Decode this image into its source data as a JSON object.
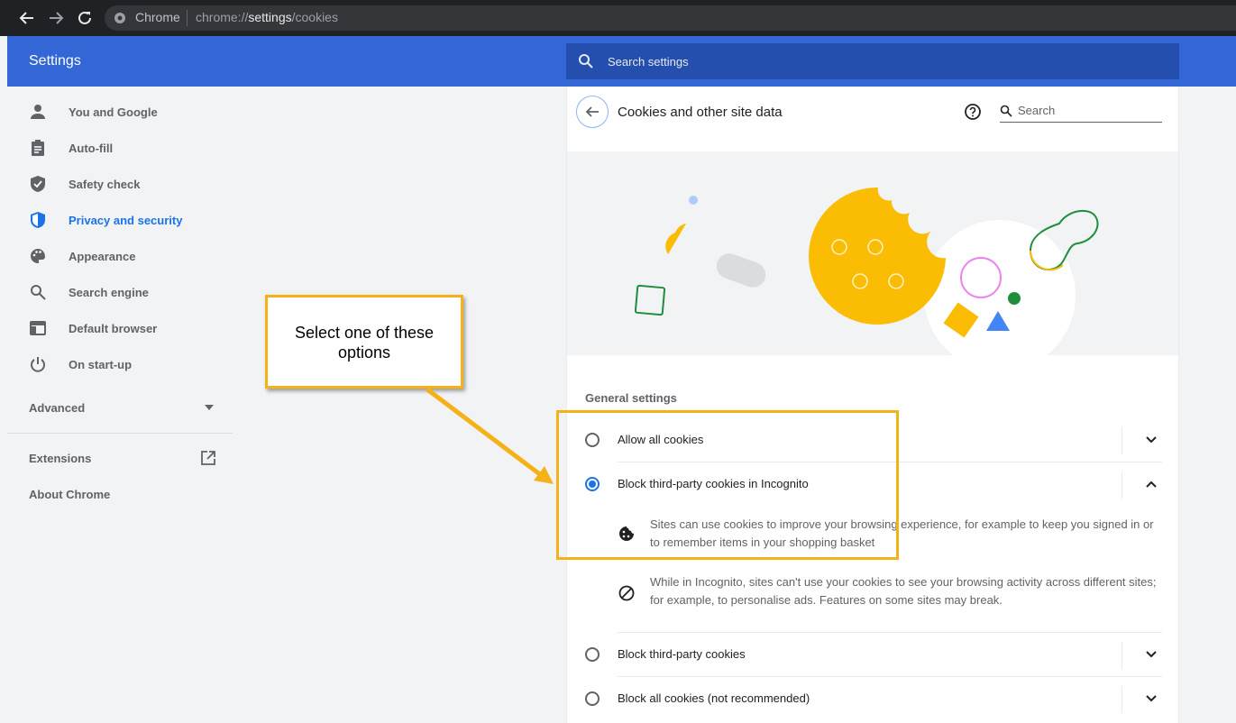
{
  "browser": {
    "site_name": "Chrome",
    "url_prefix": "chrome://",
    "url_host": "settings",
    "url_path": "/cookies"
  },
  "header": {
    "title": "Settings",
    "search_placeholder": "Search settings"
  },
  "sidebar": {
    "items": [
      {
        "label": "You and Google",
        "icon": "person-icon"
      },
      {
        "label": "Auto-fill",
        "icon": "clipboard-icon"
      },
      {
        "label": "Safety check",
        "icon": "shield-check-icon"
      },
      {
        "label": "Privacy and security",
        "icon": "shield-icon",
        "active": true
      },
      {
        "label": "Appearance",
        "icon": "palette-icon"
      },
      {
        "label": "Search engine",
        "icon": "search-icon"
      },
      {
        "label": "Default browser",
        "icon": "browser-icon"
      },
      {
        "label": "On start-up",
        "icon": "power-icon"
      }
    ],
    "advanced": "Advanced",
    "extensions": "Extensions",
    "about": "About Chrome"
  },
  "page": {
    "title": "Cookies and other site data",
    "search_placeholder": "Search",
    "section_title": "General settings",
    "options": [
      {
        "label": "Allow all cookies",
        "selected": false,
        "expanded": false
      },
      {
        "label": "Block third-party cookies in Incognito",
        "selected": true,
        "expanded": true
      },
      {
        "label": "Block third-party cookies",
        "selected": false,
        "expanded": false
      },
      {
        "label": "Block all cookies (not recommended)",
        "selected": false,
        "expanded": false
      }
    ],
    "details": [
      {
        "icon": "cookie-icon",
        "text": "Sites can use cookies to improve your browsing experience, for example to keep you signed in or to remember items in your shopping basket"
      },
      {
        "icon": "block-icon",
        "text": "While in Incognito, sites can't use your cookies to see your browsing activity across different sites; for example, to personalise ads. Features on some sites may break."
      }
    ]
  },
  "annotation": {
    "callout_text": "Select one of these options",
    "color": "#f5b218"
  },
  "colors": {
    "header": "#3367d6",
    "accent": "#1a73e8",
    "cookie": "#fbbc04"
  }
}
